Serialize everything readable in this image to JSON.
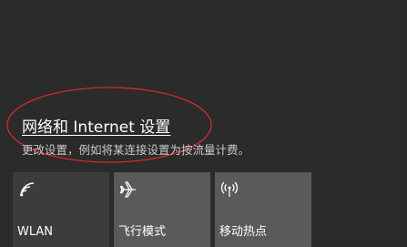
{
  "network": {
    "link_label": "网络和 Internet 设置",
    "description": "更改设置，例如将某连接设置为按流量计费。"
  },
  "quick_actions": [
    {
      "label": "WLAN",
      "icon": "wifi-icon",
      "active": false
    },
    {
      "label": "飞行模式",
      "icon": "airplane-icon",
      "active": true
    },
    {
      "label": "移动热点",
      "icon": "hotspot-icon",
      "active": true
    }
  ],
  "colors": {
    "background": "#2b2b2b",
    "tile_inactive": "#3c3c3c",
    "tile_active": "#5a5a5a",
    "annotation": "#d22b2b",
    "description_text": "#c9c9c9"
  }
}
